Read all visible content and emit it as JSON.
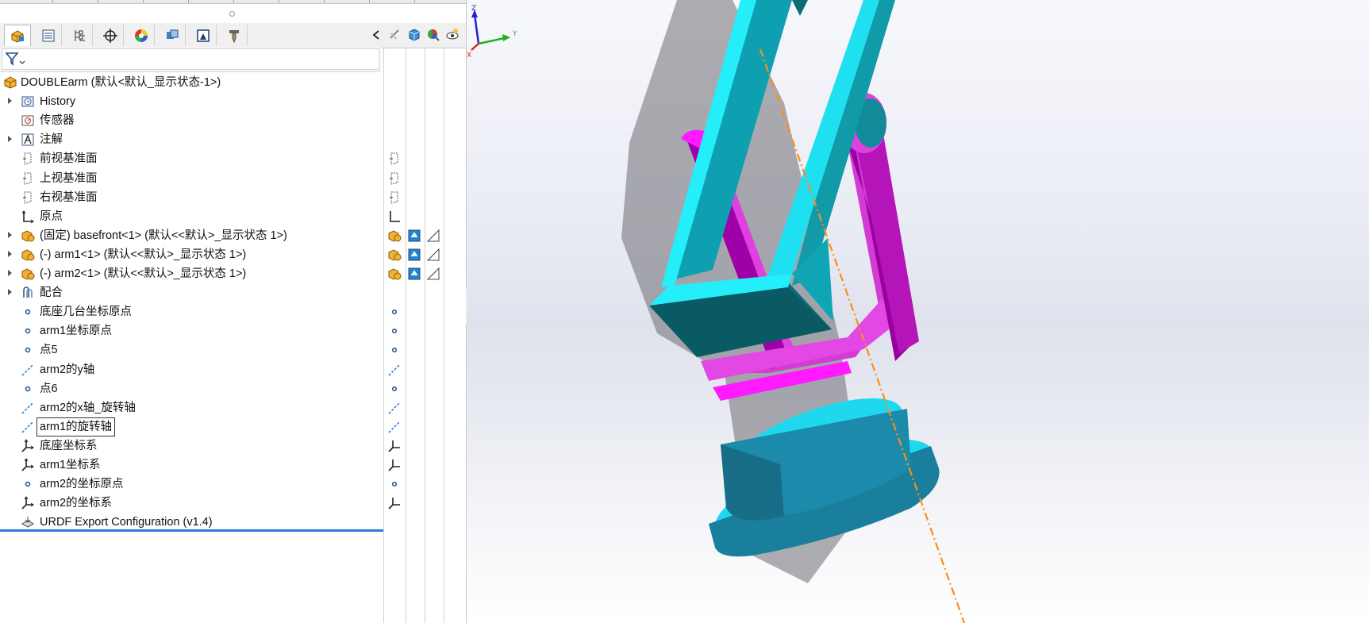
{
  "window": {
    "filter_placeholder": ""
  },
  "feature_tree": {
    "root_label": "DOUBLEarm  (默认<默认_显示状态-1>)",
    "items": [
      {
        "label": "History",
        "expandable": true,
        "icon": "history-icon"
      },
      {
        "label": "传感器",
        "expandable": false,
        "icon": "sensor-icon"
      },
      {
        "label": "注解",
        "expandable": true,
        "icon": "annotation-icon"
      },
      {
        "label": "前视基准面",
        "expandable": false,
        "icon": "plane-icon"
      },
      {
        "label": "上视基准面",
        "expandable": false,
        "icon": "plane-icon"
      },
      {
        "label": "右视基准面",
        "expandable": false,
        "icon": "plane-icon"
      },
      {
        "label": "原点",
        "expandable": false,
        "icon": "origin-icon"
      },
      {
        "label": "(固定) basefront<1> (默认<<默认>_显示状态 1>)",
        "expandable": true,
        "icon": "part-icon"
      },
      {
        "label": "(-) arm1<1> (默认<<默认>_显示状态 1>)",
        "expandable": true,
        "icon": "part-icon"
      },
      {
        "label": "(-) arm2<1> (默认<<默认>_显示状态 1>)",
        "expandable": true,
        "icon": "part-icon"
      },
      {
        "label": "配合",
        "expandable": true,
        "icon": "mates-icon"
      },
      {
        "label": "底座几台坐标原点",
        "expandable": false,
        "icon": "point-icon"
      },
      {
        "label": "arm1坐标原点",
        "expandable": false,
        "icon": "point-icon"
      },
      {
        "label": "点5",
        "expandable": false,
        "icon": "point-icon"
      },
      {
        "label": "arm2的y轴",
        "expandable": false,
        "icon": "axis-icon"
      },
      {
        "label": "点6",
        "expandable": false,
        "icon": "point-icon"
      },
      {
        "label": "arm2的x轴_旋转轴",
        "expandable": false,
        "icon": "axis-icon"
      },
      {
        "label": "arm1的旋转轴",
        "expandable": false,
        "icon": "axis-icon",
        "selected": true
      },
      {
        "label": "底座坐标系",
        "expandable": false,
        "icon": "coordinate-system-icon"
      },
      {
        "label": "arm1坐标系",
        "expandable": false,
        "icon": "coordinate-system-icon"
      },
      {
        "label": "arm2的坐标原点",
        "expandable": false,
        "icon": "point-icon"
      },
      {
        "label": "arm2的坐标系",
        "expandable": false,
        "icon": "coordinate-system-icon"
      },
      {
        "label": "URDF Export Configuration (v1.4)",
        "expandable": false,
        "icon": "urdf-icon"
      }
    ]
  },
  "manager_tabs": [
    "feature-manager-tab",
    "property-manager-tab",
    "configuration-manager-tab",
    "dimxpert-tab",
    "display-manager-tab",
    "cam-tab",
    "simulation-tab",
    "appearance-tab"
  ],
  "triad": {
    "z": "Z",
    "y": "Y",
    "x": "X"
  },
  "colors": {
    "accent": "#2a7fd4",
    "arm_cyan": "#1fe0f0",
    "arm_teal": "#0f8e9e",
    "arm_magenta": "#ff1aff",
    "base_blue": "#1f7fa0",
    "axis_orange": "#ff8c1a"
  }
}
